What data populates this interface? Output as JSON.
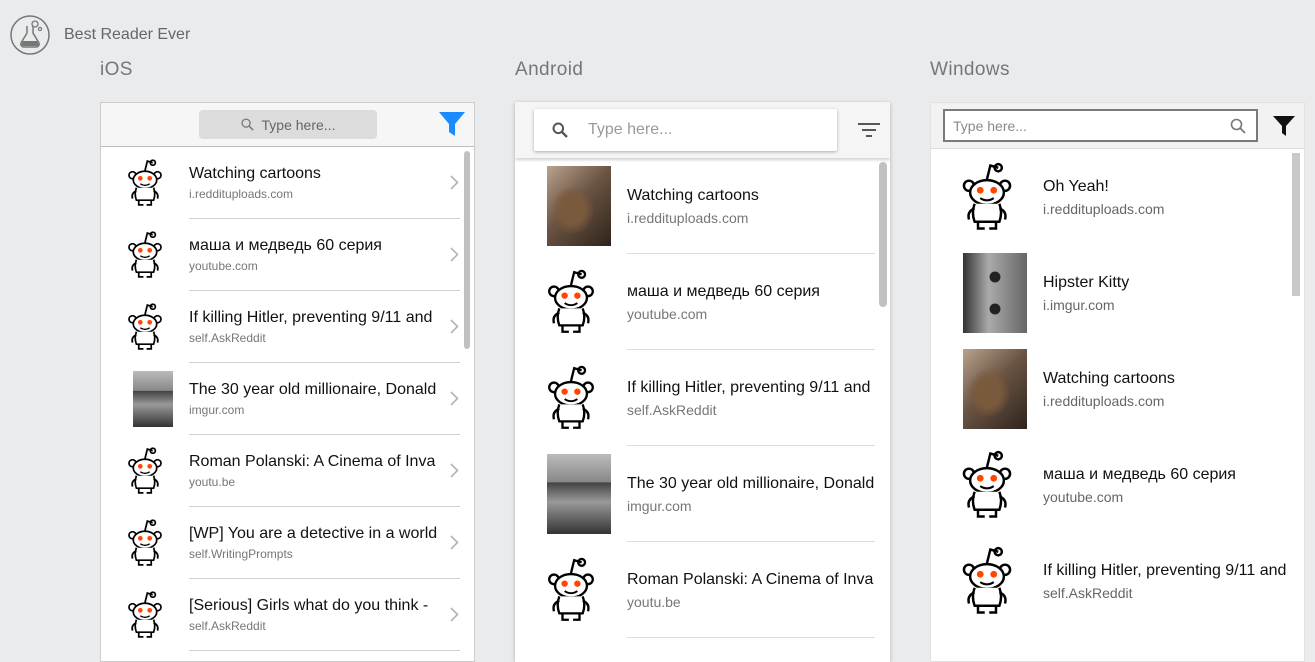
{
  "app": {
    "title": "Best Reader Ever",
    "logo_icon": "flask-icon"
  },
  "columns": {
    "ios": "iOS",
    "android": "Android",
    "windows": "Windows"
  },
  "ios": {
    "search_placeholder": "Type here...",
    "accent": "#1a8cff",
    "items": [
      {
        "title": "Watching cartoons",
        "source": "i.reddituploads.com",
        "thumb": "reddit-alien"
      },
      {
        "title": "маша и медведь 60 серия",
        "source": "youtube.com",
        "thumb": "reddit-alien"
      },
      {
        "title": "If killing Hitler, preventing 9/11 and",
        "source": "self.AskReddit",
        "thumb": "reddit-alien"
      },
      {
        "title": "The 30 year old millionaire, Donald",
        "source": "imgur.com",
        "thumb": "photo-car"
      },
      {
        "title": "Roman Polanski: A Cinema of Inva",
        "source": "youtu.be",
        "thumb": "reddit-alien"
      },
      {
        "title": "[WP] You are a detective in a world",
        "source": "self.WritingPrompts",
        "thumb": "reddit-alien"
      },
      {
        "title": "[Serious] Girls what do you think -",
        "source": "self.AskReddit",
        "thumb": "reddit-alien"
      }
    ]
  },
  "android": {
    "search_placeholder": "Type here...",
    "items": [
      {
        "title": "Watching cartoons",
        "source": "i.reddituploads.com",
        "thumb": "photo-cat"
      },
      {
        "title": "маша и медведь 60 серия",
        "source": "youtube.com",
        "thumb": "reddit-alien"
      },
      {
        "title": "If killing Hitler, preventing 9/11 and",
        "source": "self.AskReddit",
        "thumb": "reddit-alien"
      },
      {
        "title": "The 30 year old millionaire, Donald",
        "source": "imgur.com",
        "thumb": "photo-car"
      },
      {
        "title": "Roman Polanski: A Cinema of Inva",
        "source": "youtu.be",
        "thumb": "reddit-alien"
      }
    ]
  },
  "windows": {
    "search_placeholder": "Type here...",
    "items": [
      {
        "title": "Oh Yeah!",
        "source": "i.reddituploads.com",
        "thumb": "reddit-alien"
      },
      {
        "title": "Hipster Kitty",
        "source": "i.imgur.com",
        "thumb": "photo-kitty"
      },
      {
        "title": "Watching cartoons",
        "source": "i.reddituploads.com",
        "thumb": "photo-cat"
      },
      {
        "title": "маша и медведь 60 серия",
        "source": "youtube.com",
        "thumb": "reddit-alien"
      },
      {
        "title": "If killing Hitler, preventing 9/11 and",
        "source": "self.AskReddit",
        "thumb": "reddit-alien"
      }
    ]
  }
}
